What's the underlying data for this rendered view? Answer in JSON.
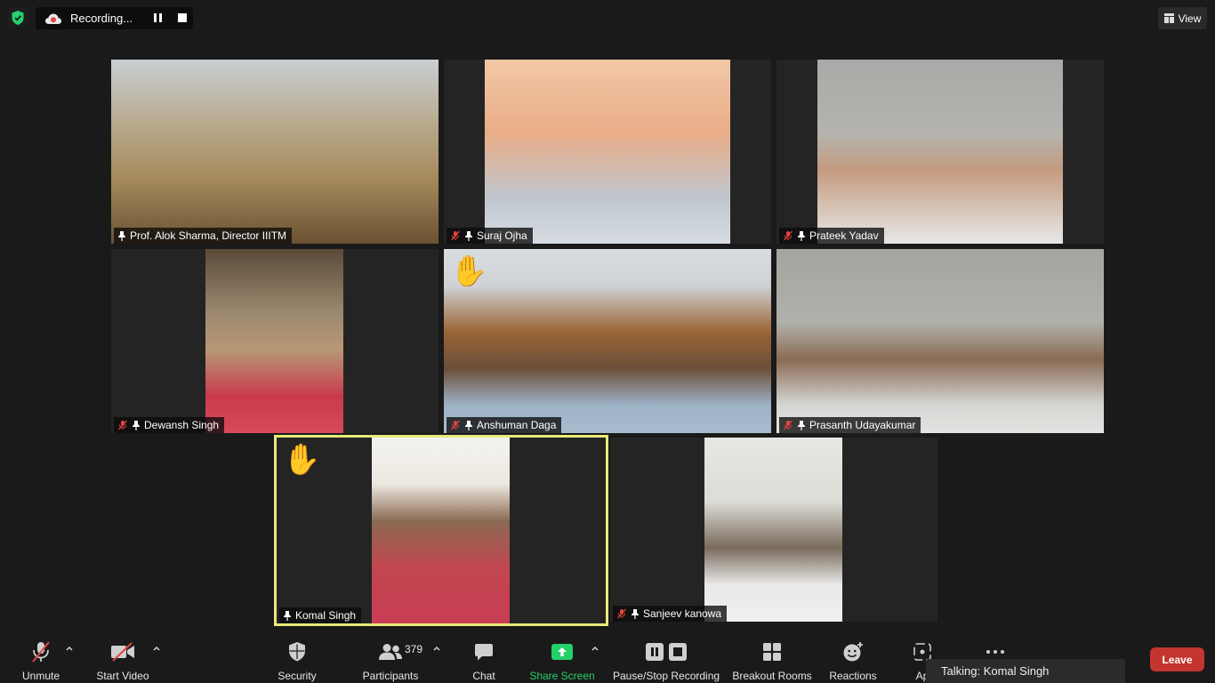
{
  "top_bar": {
    "recording_label": "Recording...",
    "view_label": "View"
  },
  "participants": [
    {
      "name": "Prof. Alok Sharma, Director IIITM",
      "muted": false,
      "hand_raised": false
    },
    {
      "name": "Suraj Ojha",
      "muted": true,
      "hand_raised": false
    },
    {
      "name": "Prateek Yadav",
      "muted": true,
      "hand_raised": false
    },
    {
      "name": "Dewansh Singh",
      "muted": true,
      "hand_raised": false
    },
    {
      "name": "Anshuman Daga",
      "muted": true,
      "hand_raised": true
    },
    {
      "name": "Prasanth Udayakumar",
      "muted": true,
      "hand_raised": false
    },
    {
      "name": "Komal Singh",
      "muted": false,
      "hand_raised": true,
      "active_speaker": true
    },
    {
      "name": "Sanjeev kanowa",
      "muted": true,
      "hand_raised": false
    }
  ],
  "toolbar": {
    "unmute": "Unmute",
    "start_video": "Start Video",
    "security": "Security",
    "participants": "Participants",
    "participants_count": "379",
    "chat": "Chat",
    "share_screen": "Share Screen",
    "pause_stop_recording": "Pause/Stop Recording",
    "breakout_rooms": "Breakout Rooms",
    "reactions": "Reactions",
    "apps": "Ap",
    "leave": "Leave"
  },
  "talking_label": "Talking: Komal Singh",
  "colors": {
    "accent_green": "#25d06b",
    "active_speaker_border": "#e8ea79",
    "leave_red": "#c5352f",
    "muted_red": "#e0453c"
  }
}
